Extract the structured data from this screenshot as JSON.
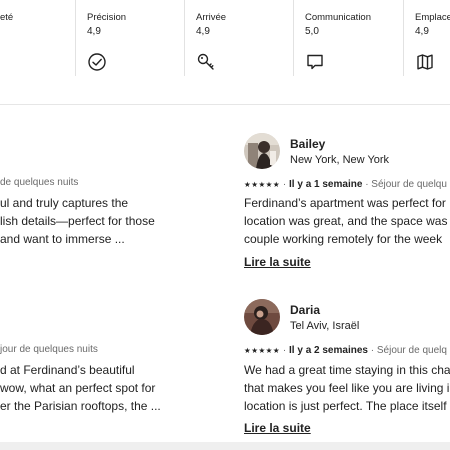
{
  "ratings": [
    {
      "label": "eté",
      "value": ""
    },
    {
      "label": "Précision",
      "value": "4,9",
      "icon": "check-circle-icon"
    },
    {
      "label": "Arrivée",
      "value": "4,9",
      "icon": "key-icon"
    },
    {
      "label": "Communication",
      "value": "5,0",
      "icon": "speech-bubble-icon"
    },
    {
      "label": "Emplace",
      "value": "4,9",
      "icon": "map-icon"
    }
  ],
  "reviews_left": [
    {
      "stay": "de quelques nuits",
      "lines": [
        "ul and truly captures the",
        "lish details—perfect for those",
        "and want to immerse ..."
      ]
    },
    {
      "stay": "jour de quelques nuits",
      "lines": [
        "d at Ferdinand’s beautiful",
        "wow, what an perfect spot for",
        "er the Parisian rooftops, the ..."
      ]
    }
  ],
  "reviews_right": [
    {
      "name": "Bailey",
      "location": "New York, New York",
      "stars": "★★★★★",
      "date": "Il y a 1 semaine",
      "stay": "Séjour de quelqu",
      "lines": [
        "Ferdinand’s apartment was perfect for",
        "location was great, and the space was",
        "couple working remotely for the week"
      ],
      "read_more": "Lire la suite"
    },
    {
      "name": "Daria",
      "location": "Tel Aviv, Israël",
      "stars": "★★★★★",
      "date": "Il y a 2 semaines",
      "stay": "Séjour de quelq",
      "lines": [
        "We had a great time staying in this cha",
        "that makes you feel like you are living i",
        "location is just perfect. The place itself"
      ],
      "read_more": "Lire la suite"
    }
  ]
}
